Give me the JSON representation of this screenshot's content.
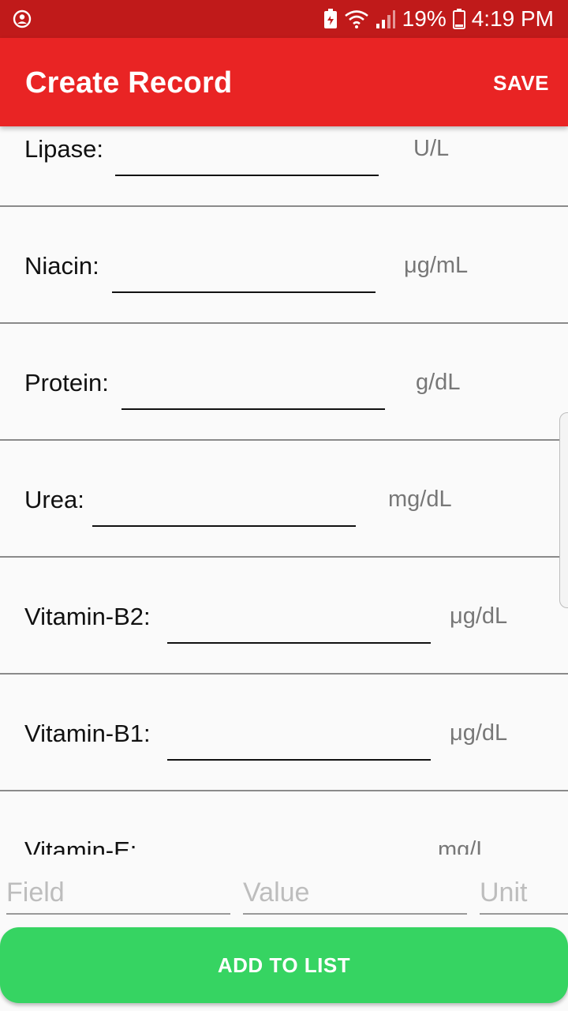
{
  "status_bar": {
    "battery_pct": "19%",
    "time": "4:19 PM",
    "icons": [
      "account-circle-icon",
      "battery-saver-icon",
      "wifi-icon",
      "signal-icon",
      "battery-icon"
    ]
  },
  "app_bar": {
    "title": "Create Record",
    "save_label": "SAVE"
  },
  "records": [
    {
      "label": "Lipase:",
      "unit": "U/L"
    },
    {
      "label": "Niacin:",
      "unit": "μg/mL"
    },
    {
      "label": "Protein:",
      "unit": "g/dL"
    },
    {
      "label": "Urea:",
      "unit": "mg/dL"
    },
    {
      "label": "Vitamin-B2:",
      "unit": "μg/dL"
    },
    {
      "label": "Vitamin-B1:",
      "unit": "μg/dL"
    },
    {
      "label": "Vitamin-E:",
      "unit": "mg/L"
    }
  ],
  "new_field": {
    "field_placeholder": "Field",
    "value_placeholder": "Value",
    "unit_placeholder": "Unit"
  },
  "add_button_label": "ADD TO LIST",
  "colors": {
    "status_bar": "#c01a1a",
    "app_bar": "#e92424",
    "add_button": "#36d462"
  }
}
